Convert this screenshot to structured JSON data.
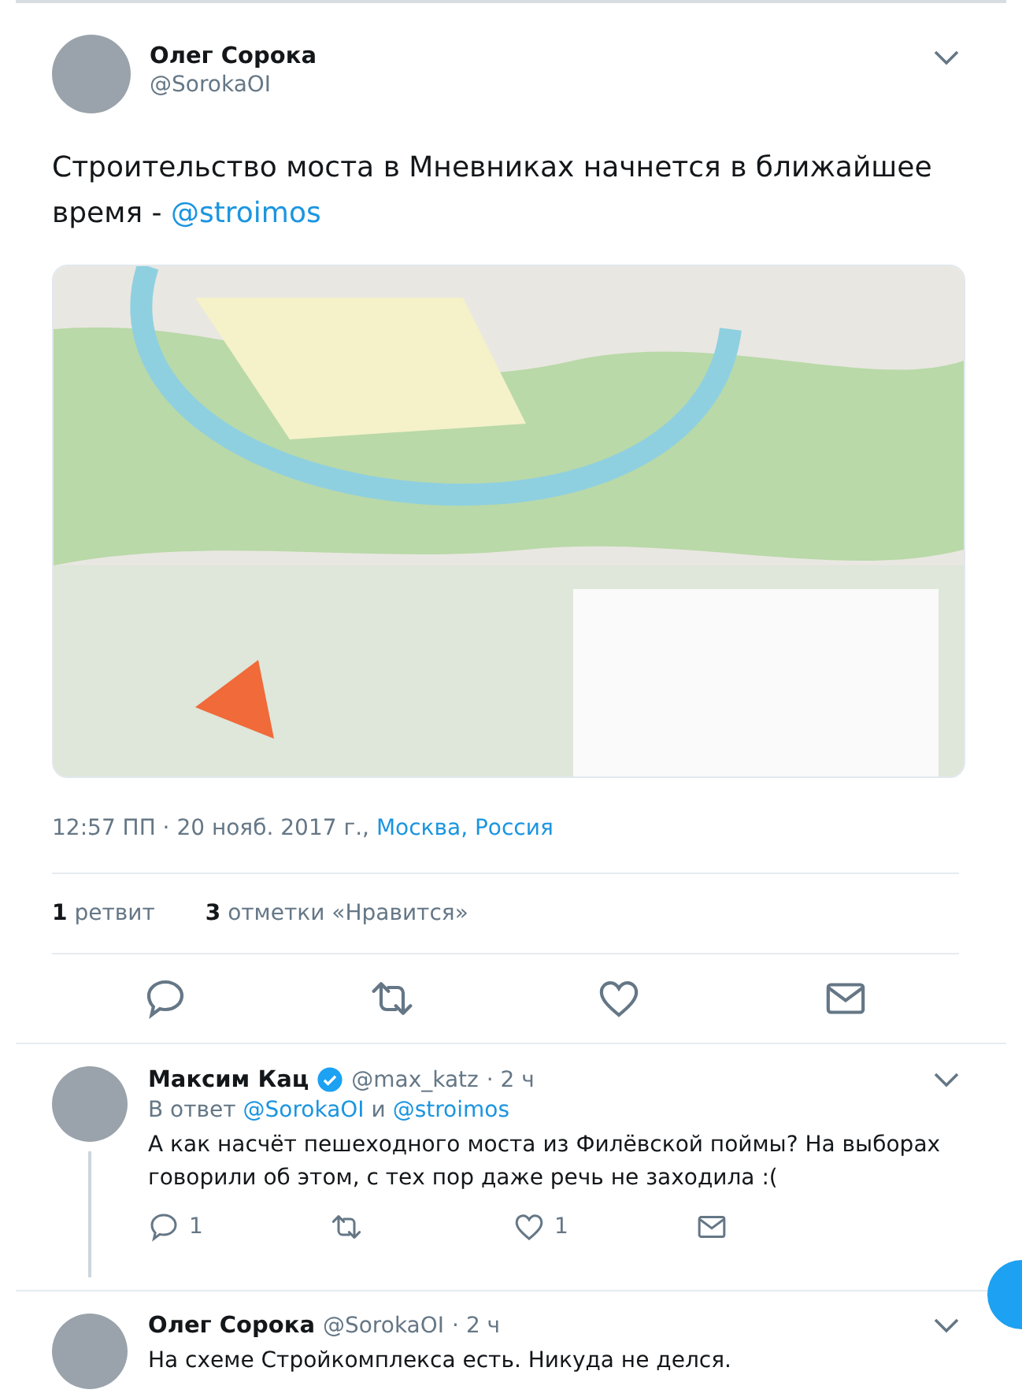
{
  "tweet": {
    "author": {
      "name": "Олег Сорока",
      "handle": "@SorokaOI"
    },
    "text": "Строительство моста в Мневниках начнется в ближайшее время - ",
    "text_link": "@stroimos",
    "timestamp": "12:57 ПП · 20 нояб. 2017 г., ",
    "location": "Москва, Россия",
    "stats": [
      {
        "count": "1",
        "label": "ретвит"
      },
      {
        "count": "3",
        "label": "отметки «Нравится»"
      }
    ],
    "actions": [
      {
        "kind": "reply"
      },
      {
        "kind": "retweet"
      },
      {
        "kind": "like"
      },
      {
        "kind": "message"
      }
    ]
  },
  "replies": [
    {
      "author": {
        "name": "Максим Кац",
        "handle": "@max_katz",
        "verified": true
      },
      "time": "· 2 ч",
      "reply_to": {
        "prefix": "В ответ",
        "first": "@SorokaOI",
        "joiner": "и",
        "second": "@stroimos"
      },
      "text": "А как насчёт пешеходного моста из Филёвской поймы? На выборах говорили об этом, с тех пор даже речь не заходила :(",
      "thread_line": true,
      "actions": [
        {
          "kind": "reply",
          "count": "1"
        },
        {
          "kind": "retweet"
        },
        {
          "kind": "like",
          "count": "1"
        },
        {
          "kind": "message"
        }
      ]
    },
    {
      "author": {
        "name": "Олег Сорока",
        "handle": "@SorokaOI",
        "verified": false
      },
      "time": "· 2 ч",
      "text": "На схеме Стройкомплекса есть. Никуда не делся.",
      "thread_line": false
    }
  ]
}
